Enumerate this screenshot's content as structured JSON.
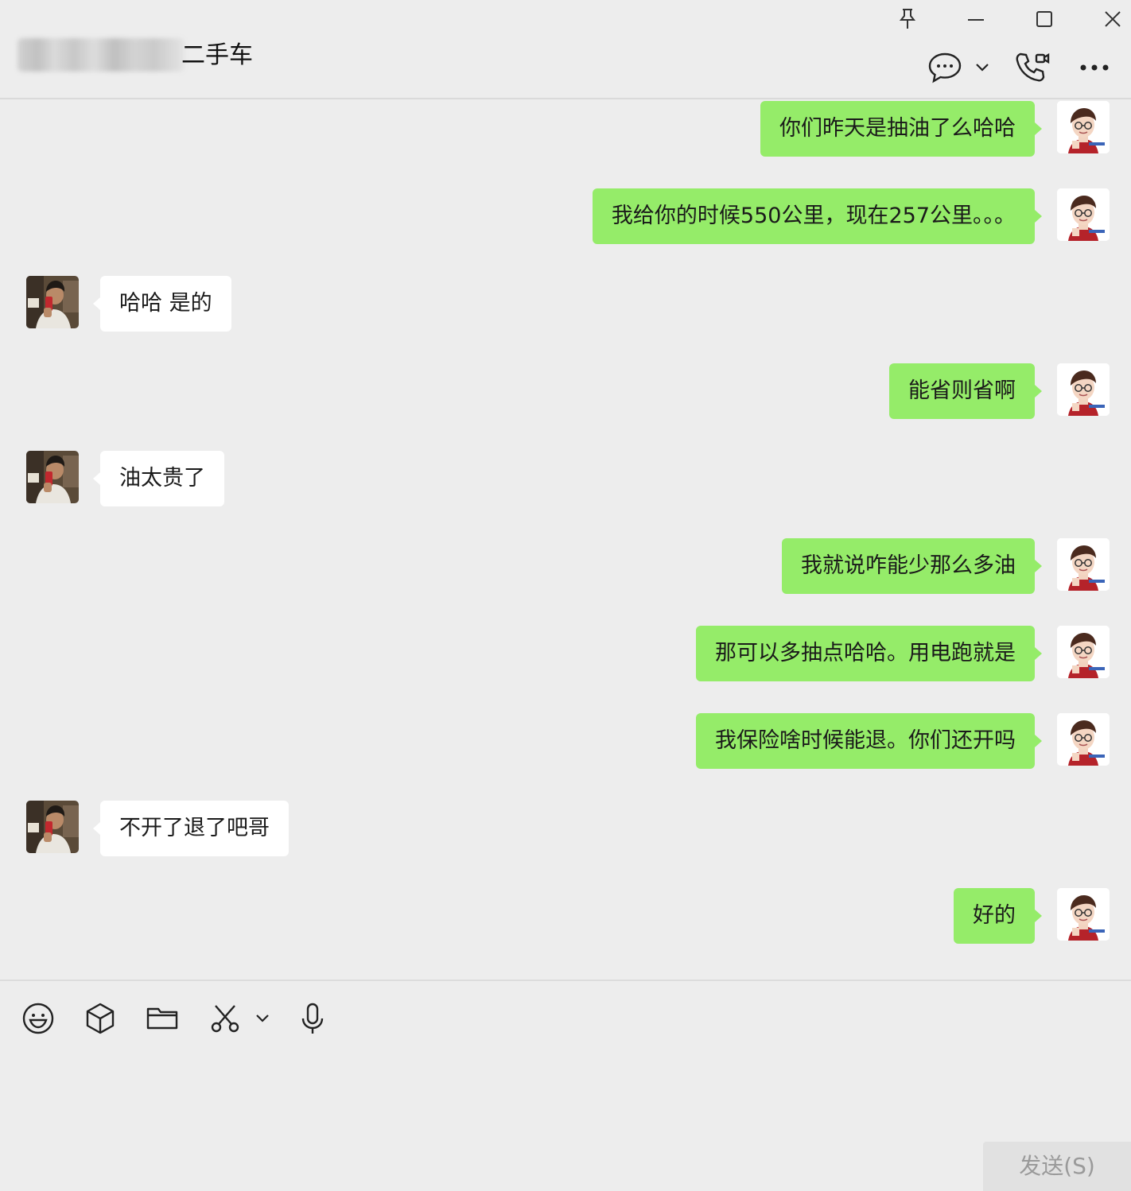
{
  "header": {
    "title_suffix": "二手车"
  },
  "messages": [
    {
      "side": "right",
      "text": "你们昨天是抽油了么哈哈"
    },
    {
      "side": "right",
      "text": "我给你的时候550公里，现在257公里。。。"
    },
    {
      "side": "left",
      "text": "哈哈 是的"
    },
    {
      "side": "right",
      "text": "能省则省啊"
    },
    {
      "side": "left",
      "text": "油太贵了"
    },
    {
      "side": "right",
      "text": "我就说咋能少那么多油"
    },
    {
      "side": "right",
      "text": "那可以多抽点哈哈。用电跑就是"
    },
    {
      "side": "right",
      "text": "我保险啥时候能退。你们还开吗"
    },
    {
      "side": "left",
      "text": "不开了退了吧哥"
    },
    {
      "side": "right",
      "text": "好的"
    }
  ],
  "composer": {
    "send_label": "发送(S)",
    "input_value": ""
  },
  "icons": {
    "window": [
      "pin-icon",
      "minimize-icon",
      "maximize-icon",
      "close-icon"
    ],
    "header": [
      "chat-bubble-icon",
      "chevron-down-icon",
      "video-call-icon",
      "more-icon"
    ],
    "toolbar": [
      "emoji-icon",
      "sticker-box-icon",
      "folder-icon",
      "scissors-icon",
      "chevron-down-icon",
      "microphone-icon"
    ]
  },
  "colors": {
    "background": "#ededed",
    "bubble_self": "#95ec69",
    "bubble_other": "#ffffff",
    "send_button": "#e1e1e1"
  }
}
